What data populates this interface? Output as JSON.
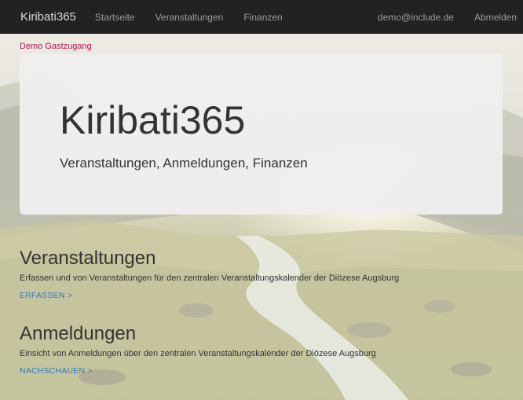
{
  "navbar": {
    "brand": "Kiribati365",
    "links": [
      "Startseite",
      "Veranstaltungen",
      "Finanzen"
    ],
    "user_email": "demo@include.de",
    "logout_label": "Abmelden"
  },
  "demo_label": "Demo Gastzugang",
  "jumbotron": {
    "title": "Kiribati365",
    "subtitle": "Veranstaltungen, Anmeldungen, Finanzen"
  },
  "sections": [
    {
      "heading": "Veranstaltungen",
      "description": "Erfassen und von Veranstaltungen für den zentralen Veranstaltungskalender der Diözese Augsburg",
      "link_label": "ERFASSEN >"
    },
    {
      "heading": "Anmeldungen",
      "description": "Einsicht von Anmeldungen über den zentralen Veranstaltungskalender der Diözese Augsburg",
      "link_label": "NACHSCHAUEN >"
    }
  ],
  "colors": {
    "navbar_bg": "#222222",
    "demo_label": "#b0124f",
    "link": "#337ab7"
  }
}
